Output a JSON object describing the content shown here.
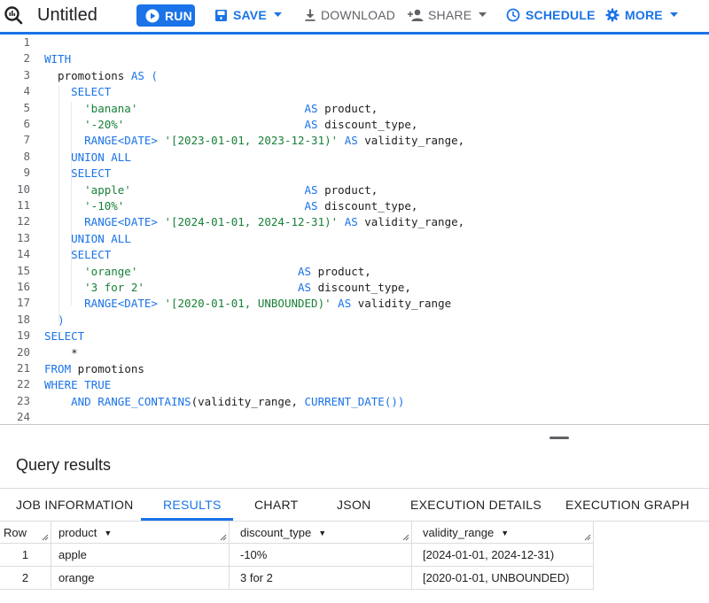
{
  "toolbar": {
    "title": "Untitled",
    "run_label": "RUN",
    "save_label": "SAVE",
    "download_label": "DOWNLOAD",
    "share_label": "SHARE",
    "schedule_label": "SCHEDULE",
    "more_label": "MORE"
  },
  "editor": {
    "line_numbers": [
      "1",
      "2",
      "3",
      "4",
      "5",
      "6",
      "7",
      "8",
      "9",
      "10",
      "11",
      "12",
      "13",
      "14",
      "15",
      "16",
      "17",
      "18",
      "19",
      "20",
      "21",
      "22",
      "23",
      "24"
    ],
    "lines": [
      [],
      [
        [
          "k",
          "WITH"
        ]
      ],
      [
        [
          "t",
          "  promotions "
        ],
        [
          "k",
          "AS"
        ],
        [
          "t",
          " "
        ],
        [
          "k",
          "("
        ]
      ],
      [
        [
          "t",
          "    "
        ],
        [
          "k",
          "SELECT"
        ]
      ],
      [
        [
          "t",
          "      "
        ],
        [
          "s",
          "'banana'"
        ],
        [
          "t",
          "                         "
        ],
        [
          "k",
          "AS"
        ],
        [
          "t",
          " product,"
        ]
      ],
      [
        [
          "t",
          "      "
        ],
        [
          "s",
          "'-20%'"
        ],
        [
          "t",
          "                           "
        ],
        [
          "k",
          "AS"
        ],
        [
          "t",
          " discount_type,"
        ]
      ],
      [
        [
          "t",
          "      "
        ],
        [
          "k",
          "RANGE<DATE>"
        ],
        [
          "t",
          " "
        ],
        [
          "s",
          "'[2023-01-01, 2023-12-31)'"
        ],
        [
          "t",
          " "
        ],
        [
          "k",
          "AS"
        ],
        [
          "t",
          " validity_range,"
        ]
      ],
      [
        [
          "t",
          "    "
        ],
        [
          "k",
          "UNION ALL"
        ]
      ],
      [
        [
          "t",
          "    "
        ],
        [
          "k",
          "SELECT"
        ]
      ],
      [
        [
          "t",
          "      "
        ],
        [
          "s",
          "'apple'"
        ],
        [
          "t",
          "                          "
        ],
        [
          "k",
          "AS"
        ],
        [
          "t",
          " product,"
        ]
      ],
      [
        [
          "t",
          "      "
        ],
        [
          "s",
          "'-10%'"
        ],
        [
          "t",
          "                           "
        ],
        [
          "k",
          "AS"
        ],
        [
          "t",
          " discount_type,"
        ]
      ],
      [
        [
          "t",
          "      "
        ],
        [
          "k",
          "RANGE<DATE>"
        ],
        [
          "t",
          " "
        ],
        [
          "s",
          "'[2024-01-01, 2024-12-31)'"
        ],
        [
          "t",
          " "
        ],
        [
          "k",
          "AS"
        ],
        [
          "t",
          " validity_range,"
        ]
      ],
      [
        [
          "t",
          "    "
        ],
        [
          "k",
          "UNION ALL"
        ]
      ],
      [
        [
          "t",
          "    "
        ],
        [
          "k",
          "SELECT"
        ]
      ],
      [
        [
          "t",
          "      "
        ],
        [
          "s",
          "'orange'"
        ],
        [
          "t",
          "                        "
        ],
        [
          "k",
          "AS"
        ],
        [
          "t",
          " product,"
        ]
      ],
      [
        [
          "t",
          "      "
        ],
        [
          "s",
          "'3 for 2'"
        ],
        [
          "t",
          "                       "
        ],
        [
          "k",
          "AS"
        ],
        [
          "t",
          " discount_type,"
        ]
      ],
      [
        [
          "t",
          "      "
        ],
        [
          "k",
          "RANGE<DATE>"
        ],
        [
          "t",
          " "
        ],
        [
          "s",
          "'[2020-01-01, UNBOUNDED)'"
        ],
        [
          "t",
          " "
        ],
        [
          "k",
          "AS"
        ],
        [
          "t",
          " validity_range"
        ]
      ],
      [
        [
          "t",
          "  "
        ],
        [
          "k",
          ")"
        ]
      ],
      [
        [
          "k",
          "SELECT"
        ]
      ],
      [
        [
          "t",
          "    *"
        ]
      ],
      [
        [
          "k",
          "FROM"
        ],
        [
          "t",
          " promotions"
        ]
      ],
      [
        [
          "k",
          "WHERE"
        ],
        [
          "t",
          " "
        ],
        [
          "k",
          "TRUE"
        ]
      ],
      [
        [
          "t",
          "    "
        ],
        [
          "k",
          "AND"
        ],
        [
          "t",
          " "
        ],
        [
          "k",
          "RANGE_CONTAINS"
        ],
        [
          "t",
          "(validity_range, "
        ],
        [
          "k",
          "CURRENT_DATE"
        ],
        [
          "k",
          "()"
        ],
        [
          "k",
          ")"
        ]
      ],
      []
    ]
  },
  "results": {
    "title": "Query results",
    "tabs": [
      "JOB INFORMATION",
      "RESULTS",
      "CHART",
      "JSON",
      "EXECUTION DETAILS",
      "EXECUTION GRAPH"
    ],
    "active_tab": "RESULTS",
    "columns": {
      "row": "Row",
      "product": "product",
      "discount_type": "discount_type",
      "validity_range": "validity_range"
    },
    "rows": [
      {
        "row": "1",
        "product": "apple",
        "discount_type": "-10%",
        "validity_range": "[2024-01-01, 2024-12-31)"
      },
      {
        "row": "2",
        "product": "orange",
        "discount_type": "3 for 2",
        "validity_range": "[2020-01-01, UNBOUNDED)"
      }
    ]
  },
  "colors": {
    "accent": "#1a73e8",
    "keyword": "#1a73e8",
    "string": "#188038"
  },
  "icons": {
    "app": "bigquery-magnifier-icon",
    "run": "play-circle-icon",
    "save": "save-icon",
    "download": "download-icon",
    "share": "person-add-icon",
    "schedule": "clock-icon",
    "more": "gear-icon"
  }
}
